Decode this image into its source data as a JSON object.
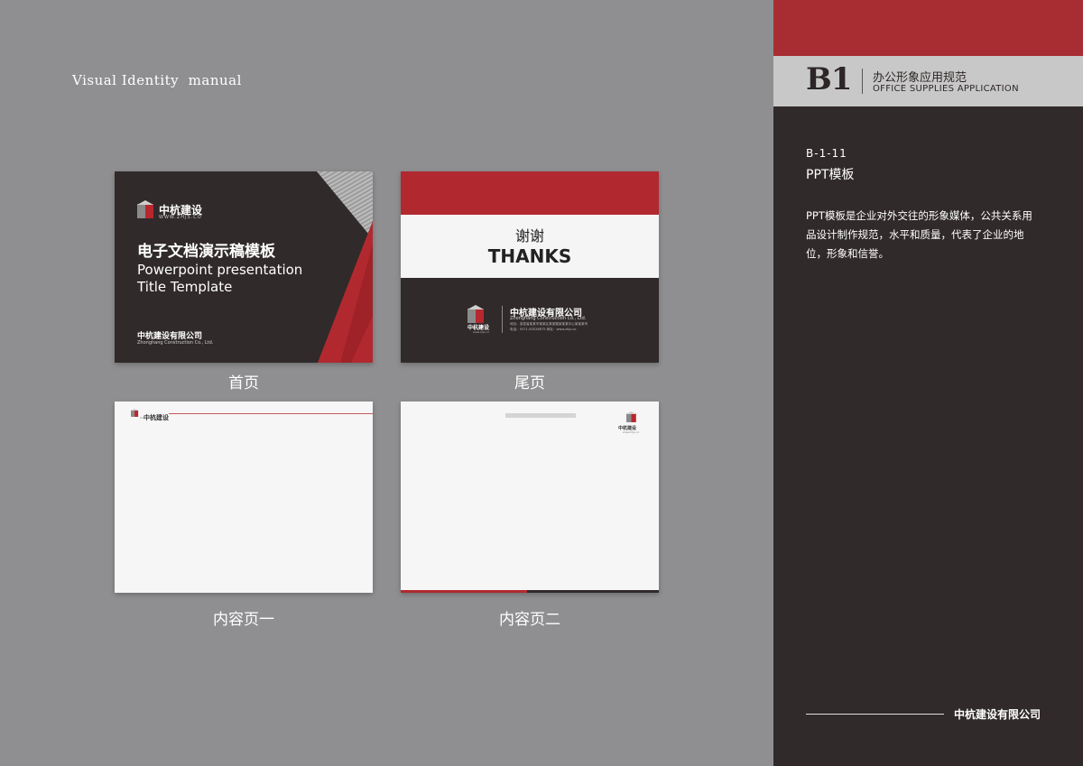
{
  "header": {
    "manual_title": "Visual Identity  manual"
  },
  "cards": {
    "cover": {
      "logo_text": "中杭建设",
      "logo_url": "WWW.ZHJS.CO",
      "title_cn": "电子文档演示稿模板",
      "title_en_line1": "Powerpoint presentation",
      "title_en_line2": "Title Template",
      "company_cn": "中杭建设有限公司",
      "company_en": "Zhonghang Construction Co., Ltd.",
      "caption": "首页"
    },
    "ending": {
      "thanks_cn": "谢谢",
      "thanks_en": "THANKS",
      "logo_text": "中杭建设",
      "logo_url": "www.zhjs.co",
      "company_cn": "中杭建设有限公司",
      "company_en": "Zhonghang Construction Co., Ltd.",
      "address": "地址：浙县省某某市某某区某某路某某某中心某某某号",
      "tel": "电话：0571-63526875   网址：www.zhjs.co",
      "caption": "尾页"
    },
    "content1": {
      "logo_text": "中杭建设",
      "logo_url": "www.zhjs.co",
      "caption": "内容页一"
    },
    "content2": {
      "logo_text": "中杭建设",
      "logo_url": "www.zhjs.co",
      "caption": "内容页二"
    }
  },
  "sidebar": {
    "section_code": "B1",
    "section_cn": "办公形象应用规范",
    "section_en": "OFFICE SUPPLIES APPLICATION",
    "item_code": "B-1-11",
    "item_name": "PPT模板",
    "description": "PPT模板是企业对外交往的形象媒体，公共关系用品设计制作规范，水平和质量，代表了企业的地位，形象和信誉。",
    "footer_company": "中杭建设有限公司"
  },
  "colors": {
    "brand_red": "#b1292f",
    "brand_dark": "#312a2a",
    "background_grey": "#8f8f91"
  }
}
